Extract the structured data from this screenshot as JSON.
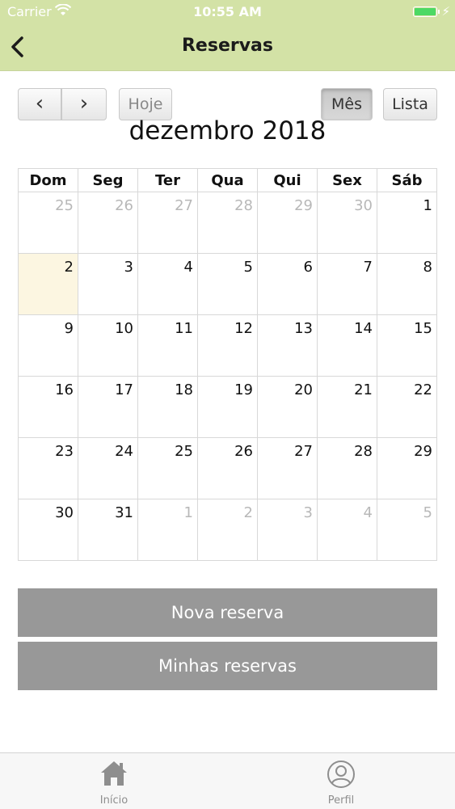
{
  "status_bar": {
    "carrier": "Carrier",
    "time": "10:55 AM"
  },
  "nav": {
    "title": "Reservas",
    "back_icon": "chevron-left-icon"
  },
  "toolbar": {
    "prev_label": "‹",
    "next_label": "›",
    "today_label": "Hoje",
    "month_label": "Mês",
    "list_label": "Lista",
    "active_view": "Mês"
  },
  "calendar": {
    "title": "dezembro 2018",
    "weekdays": [
      "Dom",
      "Seg",
      "Ter",
      "Qua",
      "Qui",
      "Sex",
      "Sáb"
    ],
    "weeks": [
      [
        {
          "d": "25",
          "other": true
        },
        {
          "d": "26",
          "other": true
        },
        {
          "d": "27",
          "other": true
        },
        {
          "d": "28",
          "other": true
        },
        {
          "d": "29",
          "other": true
        },
        {
          "d": "30",
          "other": true
        },
        {
          "d": "1"
        }
      ],
      [
        {
          "d": "2",
          "today": true
        },
        {
          "d": "3"
        },
        {
          "d": "4"
        },
        {
          "d": "5"
        },
        {
          "d": "6"
        },
        {
          "d": "7"
        },
        {
          "d": "8"
        }
      ],
      [
        {
          "d": "9"
        },
        {
          "d": "10"
        },
        {
          "d": "11"
        },
        {
          "d": "12"
        },
        {
          "d": "13"
        },
        {
          "d": "14"
        },
        {
          "d": "15"
        }
      ],
      [
        {
          "d": "16"
        },
        {
          "d": "17"
        },
        {
          "d": "18"
        },
        {
          "d": "19"
        },
        {
          "d": "20"
        },
        {
          "d": "21"
        },
        {
          "d": "22"
        }
      ],
      [
        {
          "d": "23"
        },
        {
          "d": "24"
        },
        {
          "d": "25"
        },
        {
          "d": "26"
        },
        {
          "d": "27"
        },
        {
          "d": "28"
        },
        {
          "d": "29"
        }
      ],
      [
        {
          "d": "30"
        },
        {
          "d": "31"
        },
        {
          "d": "1",
          "other": true
        },
        {
          "d": "2",
          "other": true
        },
        {
          "d": "3",
          "other": true
        },
        {
          "d": "4",
          "other": true
        },
        {
          "d": "5",
          "other": true
        }
      ]
    ]
  },
  "actions": {
    "new_reservation": "Nova reserva",
    "my_reservations": "Minhas reservas"
  },
  "tabbar": {
    "home_label": "Início",
    "profile_label": "Perfil",
    "home_icon": "home-icon",
    "profile_icon": "user-circle-icon"
  },
  "colors": {
    "header_bg": "#d3e2a6",
    "today_bg": "#fcf6e1",
    "action_bg": "#989898"
  }
}
